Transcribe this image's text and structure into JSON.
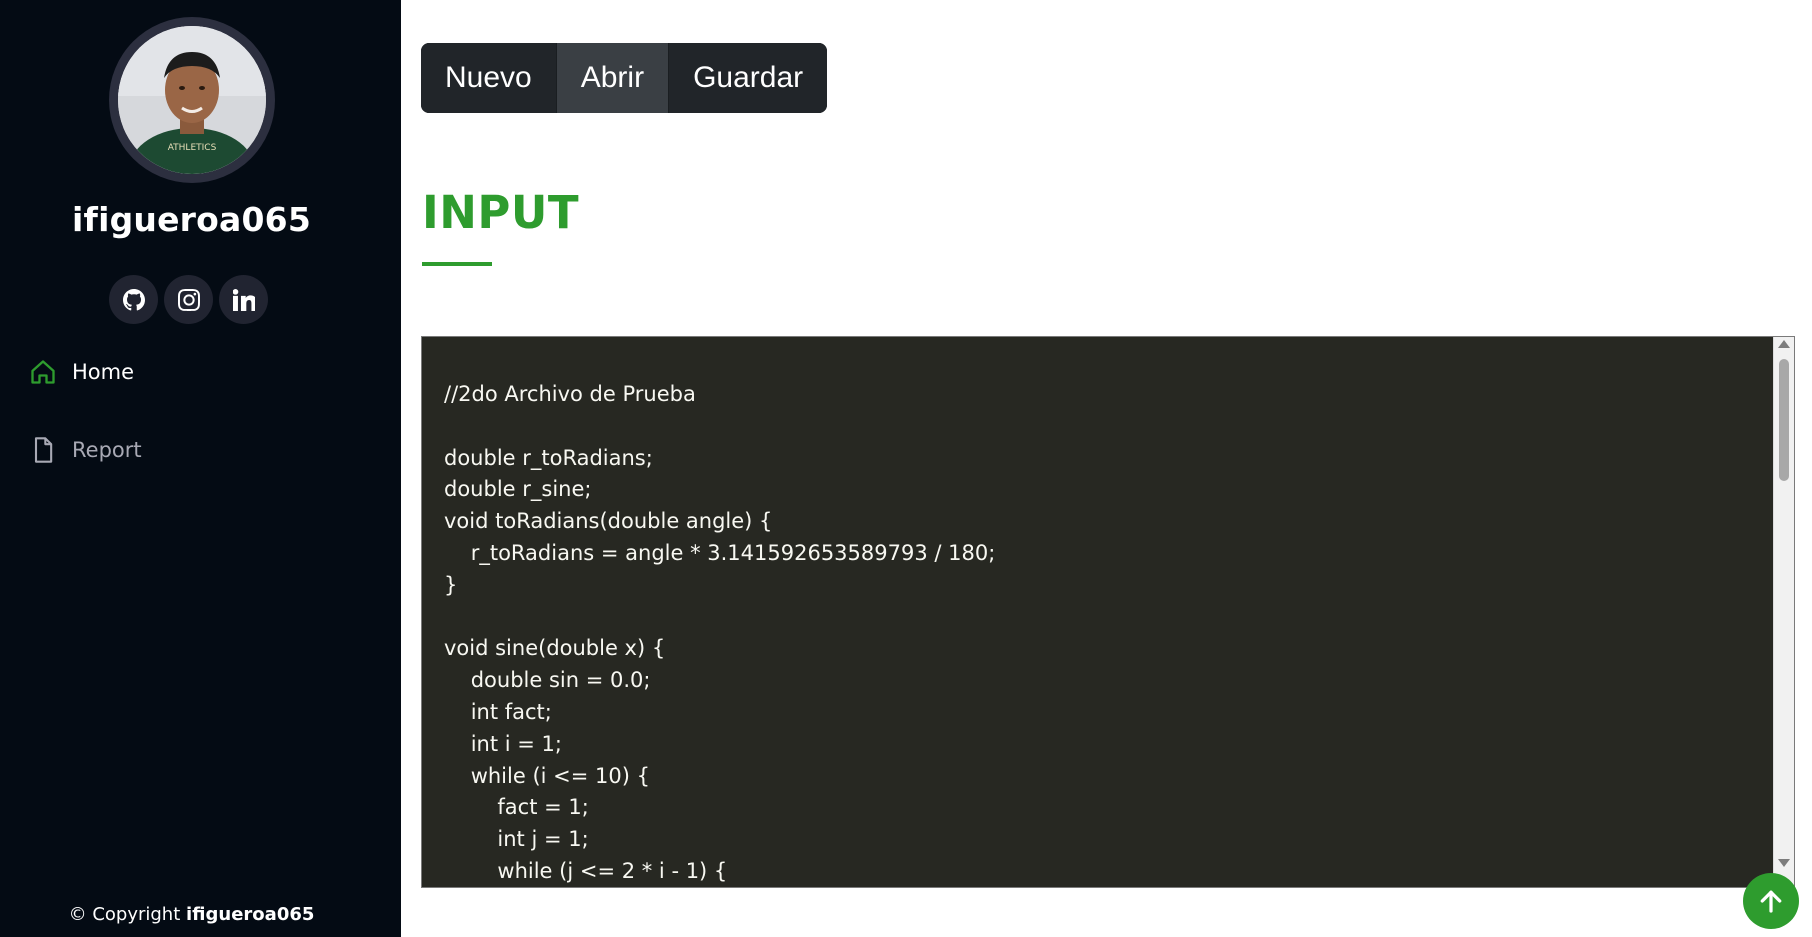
{
  "profile": {
    "username": "ifigueroa065",
    "socials": [
      {
        "icon": "github-icon"
      },
      {
        "icon": "instagram-icon"
      },
      {
        "icon": "linkedin-icon"
      }
    ]
  },
  "nav": {
    "items": [
      {
        "label": "Home",
        "icon": "home-icon",
        "active": true
      },
      {
        "label": "Report",
        "icon": "file-icon",
        "active": false
      }
    ]
  },
  "footer": {
    "prefix": "© Copyright",
    "name": "ifigueroa065"
  },
  "toolbar": {
    "new_label": "Nuevo",
    "open_label": "Abrir",
    "save_label": "Guardar"
  },
  "section": {
    "title": "INPUT"
  },
  "editor": {
    "content": "//2do Archivo de Prueba\n\ndouble r_toRadians;\ndouble r_sine;\nvoid toRadians(double angle) {\n    r_toRadians = angle * 3.141592653589793 / 180;\n}\n\nvoid sine(double x) {\n    double sin = 0.0;\n    int fact;\n    int i = 1;\n    while (i <= 10) {\n        fact = 1;\n        int j = 1;\n        while (j <= 2 * i - 1) {"
  },
  "colors": {
    "accent": "#2e9c2e",
    "sidebar_bg": "#040b14",
    "editor_bg": "#272822"
  }
}
